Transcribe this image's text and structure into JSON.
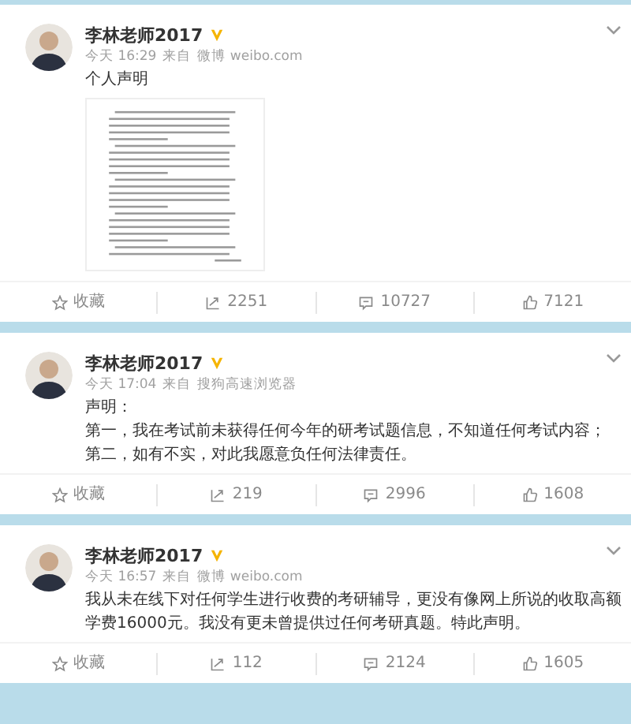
{
  "posts": [
    {
      "author": "李林老师2017",
      "time": "今天 16:29",
      "source_prefix": "来自",
      "source": "微博 weibo.com",
      "paragraphs": [
        "个人声明"
      ],
      "actions": {
        "favorite": "收藏",
        "reposts": "2251",
        "comments": "10727",
        "likes": "7121"
      }
    },
    {
      "author": "李林老师2017",
      "time": "今天 17:04",
      "source_prefix": "来自",
      "source": "搜狗高速浏览器",
      "paragraphs": [
        "声明：",
        "第一，我在考试前未获得任何今年的研考试题信息，不知道任何考试内容；",
        "第二，如有不实，对此我愿意负任何法律责任。"
      ],
      "actions": {
        "favorite": "收藏",
        "reposts": "219",
        "comments": "2996",
        "likes": "1608"
      }
    },
    {
      "author": "李林老师2017",
      "time": "今天 16:57",
      "source_prefix": "来自",
      "source": "微博 weibo.com",
      "paragraphs": [
        "我从未在线下对任何学生进行收费的考研辅导，更没有像网上所说的收取高额学费16000元。我没有更未曾提供过任何考研真题。特此声明。"
      ],
      "actions": {
        "favorite": "收藏",
        "reposts": "112",
        "comments": "2124",
        "likes": "1605"
      }
    }
  ]
}
